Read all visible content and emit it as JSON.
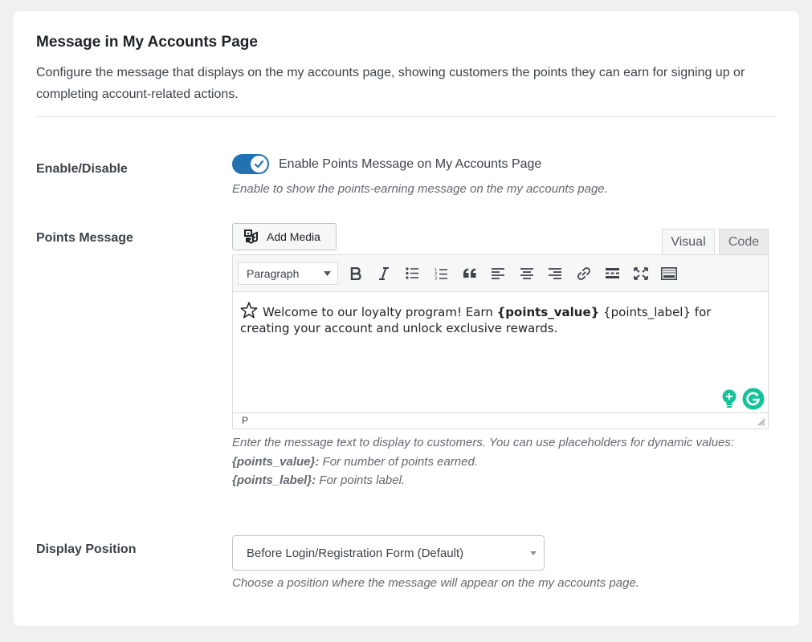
{
  "section": {
    "title": "Message in My Accounts Page",
    "description": "Configure the message that displays on the my accounts page, showing customers the points they can earn for signing up or completing account-related actions."
  },
  "enable": {
    "label": "Enable/Disable",
    "toggle_on": true,
    "toggle_label": "Enable Points Message on My Accounts Page",
    "help": "Enable to show the points-earning message on the my accounts page."
  },
  "points_message": {
    "label": "Points Message",
    "add_media": "Add Media",
    "tabs": {
      "visual": "Visual",
      "code": "Code"
    },
    "format_select": "Paragraph",
    "toolbar_icons": [
      "bold-icon",
      "italic-icon",
      "bullet-list-icon",
      "numbered-list-icon",
      "blockquote-icon",
      "align-left-icon",
      "align-center-icon",
      "align-right-icon",
      "link-icon",
      "read-more-icon",
      "fullscreen-icon",
      "toolbar-toggle-icon"
    ],
    "content": {
      "text_before": "Welcome to our loyalty program! Earn ",
      "placeholder_value": "{points_value}",
      "text_middle": " {points_label} for creating your account and unlock exclusive rewards."
    },
    "status_path": "P",
    "help_line1": "Enter the message text to display to customers. You can use placeholders for dynamic values:",
    "help_ph1_key": "{points_value}:",
    "help_ph1_desc": " For number of points earned.",
    "help_ph2_key": "{points_label}:",
    "help_ph2_desc": " For points label."
  },
  "display_position": {
    "label": "Display Position",
    "selected": "Before Login/Registration Form (Default)",
    "help": "Choose a position where the message will appear on the my accounts page."
  },
  "colors": {
    "toggle_on": "#2271b1",
    "grammarly_green": "#15c39a"
  }
}
